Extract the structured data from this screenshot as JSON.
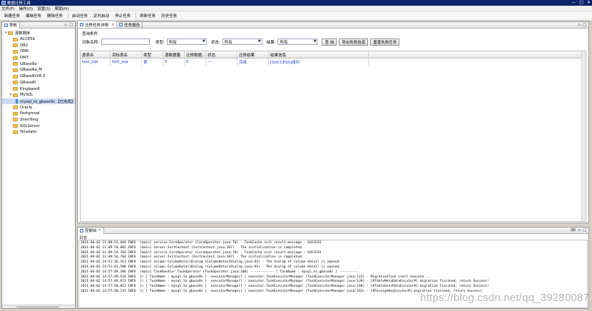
{
  "window": {
    "title": "数据迁移工具",
    "controls": [
      "—",
      "□",
      "✕"
    ]
  },
  "menu": [
    "文件(F)",
    "操作(O)",
    "设置(S)",
    "帮助(H)"
  ],
  "toolbar": [
    "新建任务",
    "编辑任务",
    "删除任务",
    "启动任务",
    "定时启动",
    "停止任务",
    "刷新任务",
    "历史任务"
  ],
  "nav": {
    "tab_label": "导航",
    "items": [
      {
        "label": "源数据库",
        "level": 0,
        "expanded": true,
        "icon": "folder"
      },
      {
        "label": "ACCESS",
        "level": 1,
        "icon": "folder"
      },
      {
        "label": "DB2",
        "level": 1,
        "icon": "folder"
      },
      {
        "label": "DM6",
        "level": 1,
        "icon": "folder"
      },
      {
        "label": "DM7",
        "level": 1,
        "icon": "folder"
      },
      {
        "label": "GBase8a",
        "level": 1,
        "icon": "folder"
      },
      {
        "label": "GBase8a_M",
        "level": 1,
        "icon": "folder"
      },
      {
        "label": "GBase8sV8.3",
        "level": 1,
        "icon": "folder"
      },
      {
        "label": "GBase8t",
        "level": 1,
        "icon": "folder"
      },
      {
        "label": "Kingbase8",
        "level": 1,
        "icon": "folder"
      },
      {
        "label": "MySQL",
        "level": 1,
        "expanded": true,
        "icon": "folder"
      },
      {
        "label": "mysql_to_gbase8s 【已完成】",
        "level": 2,
        "icon": "task",
        "selected": true
      },
      {
        "label": "Oracle",
        "level": 1,
        "icon": "folder"
      },
      {
        "label": "Postgresql",
        "level": 1,
        "icon": "folder"
      },
      {
        "label": "ShenTong",
        "level": 1,
        "icon": "folder"
      },
      {
        "label": "SQLServer",
        "level": 1,
        "icon": "folder"
      },
      {
        "label": "Teradata",
        "level": 1,
        "icon": "folder"
      }
    ]
  },
  "main": {
    "tabs": [
      {
        "label": "迁移任务详情",
        "active": true
      },
      {
        "label": "任务报告",
        "active": false
      }
    ],
    "condition_title": "查询条件",
    "filters": {
      "object_name_label": "对象名称:",
      "object_name_value": "",
      "type_label": "类型:",
      "type_value": "所有",
      "status_label": "状态:",
      "status_value": "所有",
      "result_label": "结果:",
      "result_value": "所有",
      "query_button": "查 询",
      "export_button": "导出失败信息",
      "retry_button": "重置失败任务"
    },
    "table": {
      "columns": [
        "源表名",
        "目标表名",
        "类型",
        "源数据量",
        "迁移数据...",
        "状态",
        "迁移结果",
        "结果信息",
        ""
      ],
      "rows": [
        [
          "test_jsja",
          "test_jsja",
          "表",
          "0",
          "0",
          "---",
          "完成",
          "[SUCCESS]成功",
          ""
        ]
      ]
    }
  },
  "console": {
    "tab_label": "控制台",
    "log_label": "日志",
    "lines": [
      "2021-04-02 11:09:53,944 INFO  [main] service.CoreOperator (CoreOperator.java:70) - TaskCache init result message : SUCCESS",
      "2021-04-02 11:09:54,002 INFO  [main] server.InitContext (InitContext.java:107) - The initialization is completed.",
      "2021-04-02 11:09:54,703 INFO  [main] service.CoreOperator (CoreOperator.java:70) - TaskCache init result message : SUCCESS",
      "2021-04-02 11:09:54,704 INFO  [main] server.InitContext (InitContext.java:107) - The initialization is completed.",
      "2021-04-02 14:51:36,351 INFO  [main] column.ColumnDetailDialog (ColumnDetailDialog.java:83) - The dialog of column detail is opened.",
      "2021-04-02 14:51:43,588 INFO  [main] column.ColumnDetailDialog (ColumnDetailDialog.java:83) - The dialog of column detail is opened.",
      "2021-04-02 14:57:49,386 INFO  [main] TaskHandler.TaskOperator (TaskOperator.java:100) - ---------- [ TaskName : mysql_to_gbase8s ] ----------",
      "2021-04-02 14:57:49,524 INFO  [( [ TaskName : mysql_to_gbase8s ]  executorManager] ) executor.TaskExecutorManager (TaskExecutorManager.java:122) - MigrationTask start execute ...",
      "2021-04-02 14:57:49,973 INFO  [( [ TaskName : mysql_to_gbase8s ]  executorManager] ) executor.TaskExecutorManager (TaskExecutorManager.java:139) - [#TableMetaDataExcutor#] migration finished, return Success!",
      "2021-04-02 14:57:50,013 INFO  [( [ TaskName : mysql_to_gbase8s ]  executorManager] ) executor.TaskExecutorManager (TaskExecutorManager.java:148) - [#TableUserDataExcutor#] migration finished, return Success!",
      "2021-04-02 14:57:50,137 INFO  [( [ TaskName : mysql_to_gbase8s ]  executorManager] ) executor.TaskExecutorManager (TaskExecutorManager.java:162) - [#ForeignKeyExcutor#] migration finished, return Success!"
    ]
  },
  "watermark": "https://blog.csdn.net/qq_39280087"
}
